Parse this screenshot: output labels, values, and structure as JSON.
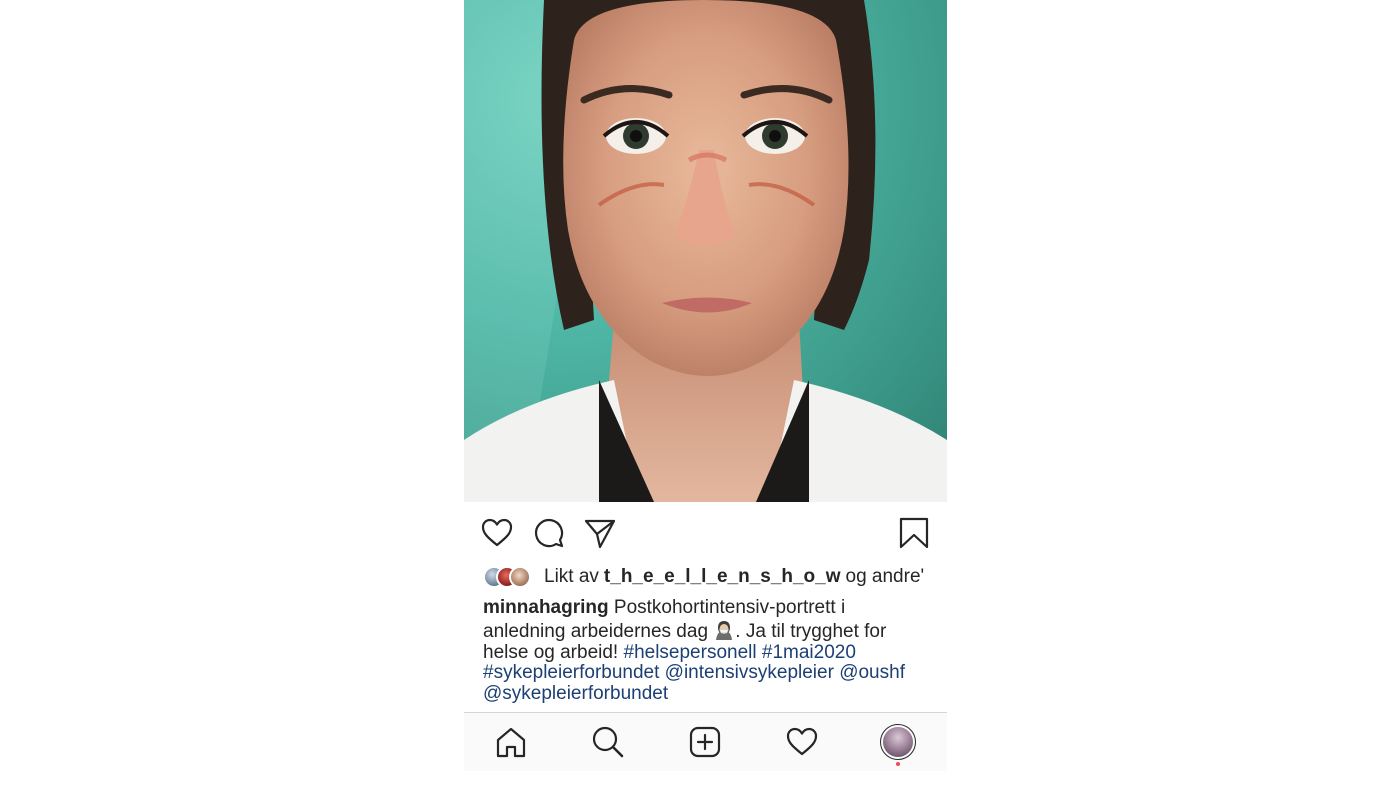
{
  "post": {
    "photo_alt": "",
    "likes": {
      "prefix": "Likt av",
      "user": "t_h_e_e_l_l_e_n_s_h_o_w",
      "suffix": "og andre'"
    },
    "caption": {
      "author": "minnahagring",
      "text_1": "Postkohortintensiv-portrett i anledning arbeidernes dag",
      "emoji": "person-with-mask",
      "text_2": ". Ja til trygghet for helse og arbeid!",
      "tags": [
        "#helsepersonell",
        "#1mai2020",
        "#sykepleierforbundet",
        "@intensivsykepleier",
        "@oushf",
        "@sykepleierforbundet"
      ]
    }
  },
  "actions": {
    "like_icon": "heart-icon",
    "comment_icon": "comment-icon",
    "share_icon": "paper-plane-icon",
    "save_icon": "bookmark-icon"
  },
  "tabbar": {
    "items": [
      "home-icon",
      "search-icon",
      "new-post-icon",
      "activity-heart-icon",
      "profile-avatar"
    ],
    "notification_color": "#ed4956"
  },
  "colors": {
    "link": "#1c3f74",
    "text": "#262626",
    "wall": "#4fb6a5"
  }
}
